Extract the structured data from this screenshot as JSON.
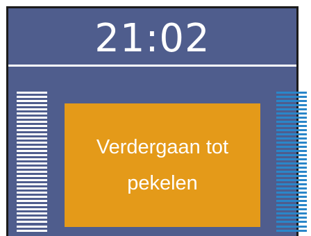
{
  "clock": {
    "time": "21:02"
  },
  "action": {
    "label": "Verdergaan tot\npekelen"
  },
  "level_left": {
    "color": "#ffffff"
  },
  "level_right": {
    "color": "#2a86c9"
  },
  "colors": {
    "panel_background": "#4f5d8d",
    "action_button": "#e49a19",
    "divider": "#ffffff"
  }
}
